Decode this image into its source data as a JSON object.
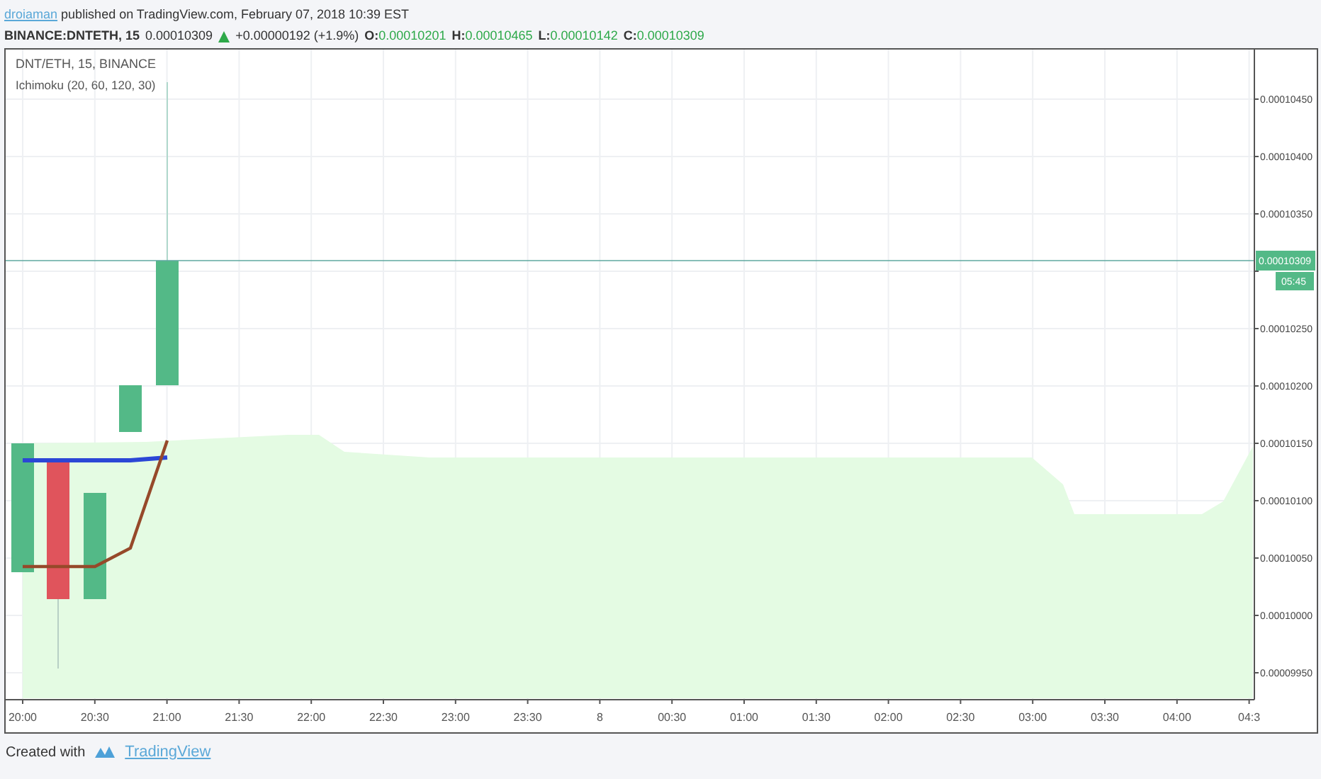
{
  "header": {
    "author": "droiaman",
    "published": "published on TradingView.com, February 07, 2018 10:39 EST"
  },
  "quote": {
    "symbol": "BINANCE:DNTETH, 15",
    "price": "0.00010309",
    "rising": true,
    "change": "+0.00000192 (+1.9%)",
    "ohlc": [
      {
        "label": "O:",
        "value": "0.00010201"
      },
      {
        "label": "H:",
        "value": "0.00010465"
      },
      {
        "label": "L:",
        "value": "0.00010142"
      },
      {
        "label": "C:",
        "value": "0.00010309"
      }
    ]
  },
  "chart": {
    "title": "DNT/ETH, 15, BINANCE",
    "indicator": "Ichimoku (20, 60, 120, 30)",
    "last_price_label": "0.00010309",
    "countdown": "05:45",
    "price_axis": [
      {
        "label": "0.00010450"
      },
      {
        "label": "0.00010400"
      },
      {
        "label": "0.00010350"
      },
      {
        "covered": true
      },
      {
        "label": "0.00010250"
      },
      {
        "label": "0.00010200"
      },
      {
        "label": "0.00010150"
      },
      {
        "label": "0.00010100"
      },
      {
        "label": "0.00010050"
      },
      {
        "label": "0.00010000"
      },
      {
        "label": "0.00009950"
      }
    ],
    "time_axis": [
      "20:00",
      "20:30",
      "21:00",
      "21:30",
      "22:00",
      "22:30",
      "23:00",
      "23:30",
      "8",
      "00:30",
      "01:00",
      "01:30",
      "02:00",
      "02:30",
      "03:00",
      "03:30",
      "04:00",
      "04:3"
    ]
  },
  "footer": {
    "text": "Created with",
    "brand": "TradingView"
  }
}
